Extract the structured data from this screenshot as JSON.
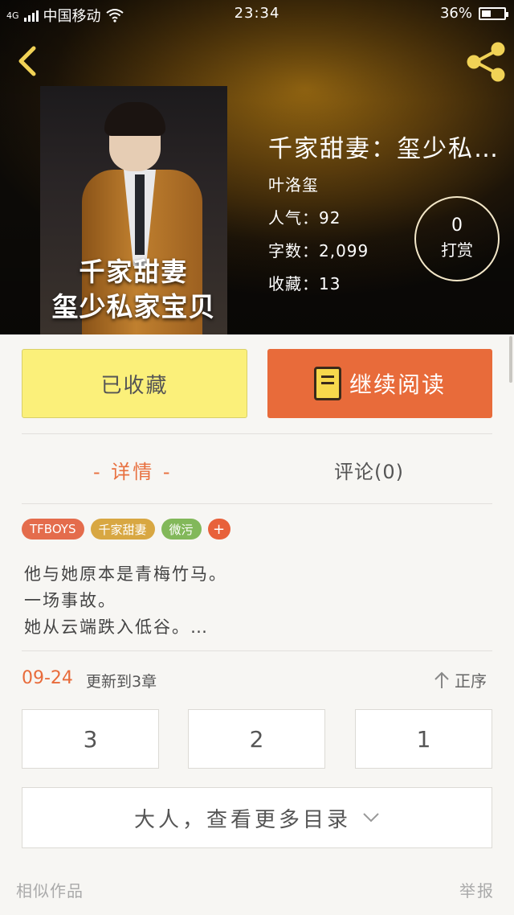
{
  "status_bar": {
    "network": "4G",
    "carrier": "中国移动",
    "time": "23:34",
    "battery_percent": "36%",
    "battery_level": 0.36
  },
  "header": {
    "back_icon": "chevron-left-icon",
    "share_icon": "share-icon"
  },
  "cover": {
    "line1": "千家甜妻",
    "line2": "玺少私家宝贝"
  },
  "book": {
    "title": "千家甜妻：玺少私…",
    "author": "叶洛玺",
    "popularity": "人气：92",
    "word_count": "字数：2,099",
    "favorites": "收藏：13"
  },
  "tip": {
    "count": "0",
    "label": "打赏"
  },
  "actions": {
    "saved_label": "已收藏",
    "read_label": "继续阅读"
  },
  "tabs": {
    "detail": "- 详情 -",
    "comments": "评论(0)"
  },
  "tags": [
    "TFBOYS",
    "千家甜妻",
    "微污",
    "+"
  ],
  "description": [
    "他与她原本是青梅竹马。",
    "一场事故。",
    "她从云端跌入低谷。…"
  ],
  "update": {
    "date": "09-24",
    "text": "更新到3章",
    "sort_label": "正序"
  },
  "chapters": [
    "3",
    "2",
    "1"
  ],
  "more_catalog": "大人，查看更多目录",
  "footer": {
    "similar": "相似作品",
    "report": "举报"
  },
  "colors": {
    "accent": "#e86b3a",
    "saved_button": "#fbf07a",
    "tag_tfboys": "#e46c4c",
    "tag_series": "#d8a742",
    "tag_genre": "#82b85a"
  }
}
